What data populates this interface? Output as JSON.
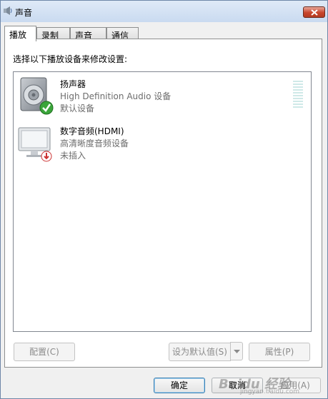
{
  "window": {
    "title": "声音"
  },
  "tabs": [
    {
      "label": "播放",
      "active": true
    },
    {
      "label": "录制",
      "active": false
    },
    {
      "label": "声音",
      "active": false
    },
    {
      "label": "通信",
      "active": false
    }
  ],
  "panel": {
    "instruction": "选择以下播放设备来修改设置:"
  },
  "devices": [
    {
      "name": "扬声器",
      "description": "High Definition Audio 设备",
      "status": "默认设备",
      "icon": "speaker-icon",
      "badge": "default-check-icon"
    },
    {
      "name": "数字音频(HDMI)",
      "description": "高清晰度音频设备",
      "status": "未插入",
      "icon": "monitor-icon",
      "badge": "unplugged-icon"
    }
  ],
  "buttons": {
    "configure": "配置(C)",
    "set_default": "设为默认值(S)",
    "properties": "属性(P)",
    "ok": "确定",
    "cancel": "取消",
    "apply": "应用(A)"
  },
  "watermark": {
    "text": "Baidu 经验",
    "sub": "jingyan.baidu.com"
  },
  "colors": {
    "accent": "#3c7fb1",
    "close_button": "#c8452c",
    "check_green": "#3aa53a"
  }
}
